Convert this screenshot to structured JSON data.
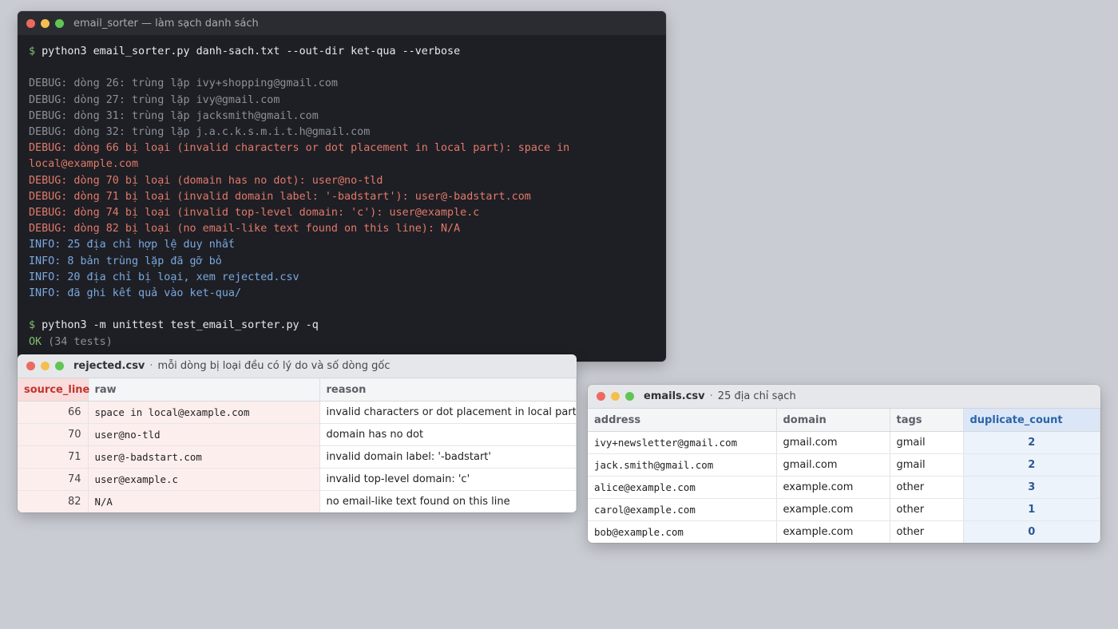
{
  "terminal": {
    "title": "email_sorter — làm sạch danh sách",
    "lines": [
      {
        "type": "cmd",
        "prompt": "$",
        "text": " python3 email_sorter.py danh-sach.txt --out-dir ket-qua --verbose"
      },
      {
        "type": "blank",
        "text": ""
      },
      {
        "type": "dbg",
        "text": "DEBUG: dòng 26: trùng lặp ivy+shopping@gmail.com"
      },
      {
        "type": "dbg",
        "text": "DEBUG: dòng 27: trùng lặp ivy@gmail.com"
      },
      {
        "type": "dbg",
        "text": "DEBUG: dòng 31: trùng lặp jacksmith@gmail.com"
      },
      {
        "type": "dbg",
        "text": "DEBUG: dòng 32: trùng lặp j.a.c.k.s.m.i.t.h@gmail.com"
      },
      {
        "type": "rej",
        "text": "DEBUG: dòng 66 bị loại (invalid characters or dot placement in local part): space in"
      },
      {
        "type": "rej",
        "text": "local@example.com"
      },
      {
        "type": "rej",
        "text": "DEBUG: dòng 70 bị loại (domain has no dot): user@no-tld"
      },
      {
        "type": "rej",
        "text": "DEBUG: dòng 71 bị loại (invalid domain label: '-badstart'): user@-badstart.com"
      },
      {
        "type": "rej",
        "text": "DEBUG: dòng 74 bị loại (invalid top-level domain: 'c'): user@example.c"
      },
      {
        "type": "rej",
        "text": "DEBUG: dòng 82 bị loại (no email-like text found on this line): N/A"
      },
      {
        "type": "info",
        "text": "INFO: 25 địa chỉ hợp lệ duy nhất"
      },
      {
        "type": "info",
        "text": "INFO: 8 bản trùng lặp đã gỡ bỏ"
      },
      {
        "type": "info",
        "text": "INFO: 20 địa chỉ bị loại, xem rejected.csv"
      },
      {
        "type": "info",
        "text": "INFO: đã ghi kết quả vào ket-qua/"
      },
      {
        "type": "blank",
        "text": ""
      },
      {
        "type": "cmd",
        "prompt": "$",
        "text": " python3 -m unittest test_email_sorter.py -q"
      },
      {
        "type": "ok",
        "ok": "OK",
        "text": " (34 tests)"
      }
    ]
  },
  "rejected": {
    "filename": "rejected.csv",
    "separator": "·",
    "description": "mỗi dòng bị loại đều có lý do và số dòng gốc",
    "columns": [
      "source_line",
      "raw",
      "reason"
    ],
    "rows": [
      [
        "66",
        "space in local@example.com",
        "invalid characters or dot placement in local part"
      ],
      [
        "70",
        "user@no-tld",
        "domain has no dot"
      ],
      [
        "71",
        "user@-badstart.com",
        "invalid domain label: '-badstart'"
      ],
      [
        "74",
        "user@example.c",
        "invalid top-level domain: 'c'"
      ],
      [
        "82",
        "N/A",
        "no email-like text found on this line"
      ]
    ]
  },
  "emails": {
    "filename": "emails.csv",
    "separator": "·",
    "description": "25 địa chỉ sạch",
    "columns": [
      "address",
      "domain",
      "tags",
      "duplicate_count"
    ],
    "rows": [
      [
        "ivy+newsletter@gmail.com",
        "gmail.com",
        "gmail",
        "2"
      ],
      [
        "jack.smith@gmail.com",
        "gmail.com",
        "gmail",
        "2"
      ],
      [
        "alice@example.com",
        "example.com",
        "other",
        "3"
      ],
      [
        "carol@example.com",
        "example.com",
        "other",
        "1"
      ],
      [
        "bob@example.com",
        "example.com",
        "other",
        "0"
      ]
    ]
  },
  "colors": {
    "desktop": "#c9ccd3",
    "terminal_bg": "#1e1f24",
    "debug_text": "#8d9098",
    "rejected_text": "#e2796b",
    "info_text": "#7aa8e0",
    "ok_text": "#7fbf6a",
    "rejected_highlight": "#f9dcdc",
    "emails_highlight": "#dbe7f7"
  }
}
